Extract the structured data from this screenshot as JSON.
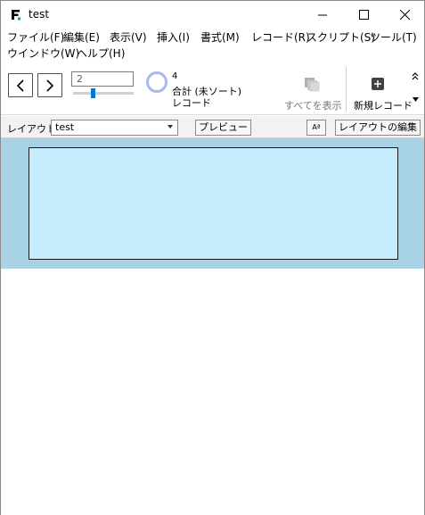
{
  "window": {
    "title": "test",
    "icon": "filemaker-icon",
    "controls": {
      "minimize": "minimize-icon",
      "maximize": "maximize-icon",
      "close": "close-icon"
    }
  },
  "menu": {
    "items": [
      "ファイル(F)",
      "編集(E)",
      "表示(V)",
      "挿入(I)",
      "書式(M)",
      "レコード(R)",
      "スクリプト(S)",
      "ツール(T)",
      "ウインドウ(W)",
      "ヘルプ(H)"
    ]
  },
  "toolbar": {
    "record_number": "2",
    "slider_position_fraction": 0.33,
    "record_count": "4",
    "found_status": "合計 (未ソート)",
    "record_unit": "レコード",
    "show_all_label": "すべてを表示",
    "new_record_label": "新規レコード",
    "collapse_icon": "double-chevron-up-icon",
    "more_icon": "caret-down-icon"
  },
  "layoutbar": {
    "label": "レイアウト:",
    "selected_layout": "test",
    "preview_label": "プレビュー",
    "font_size_label": "Aª",
    "edit_layout_label": "レイアウトの編集"
  },
  "colors": {
    "band_background": "#a8d2e6",
    "part_background": "#c4ecfc",
    "pie_ring": "#a8b9ec",
    "slider_accent": "#0078d7"
  }
}
